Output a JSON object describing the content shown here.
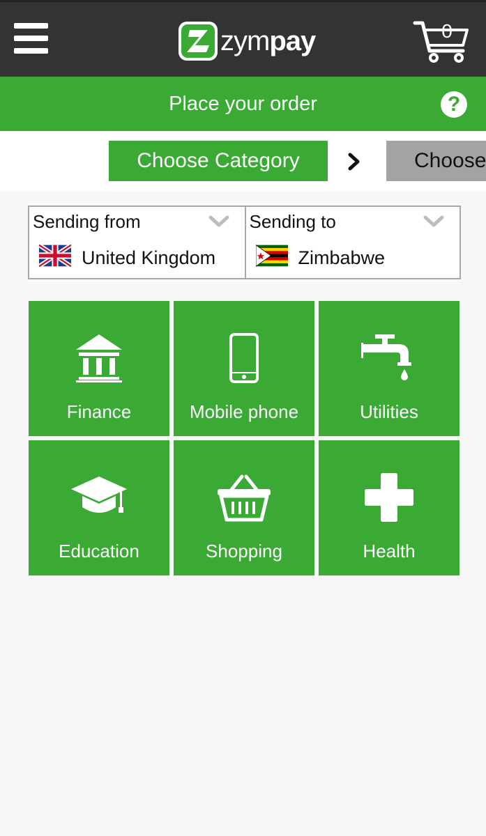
{
  "app": {
    "brand_left": "zym",
    "brand_right": "pay",
    "cart_count": "0"
  },
  "header": {
    "title": "Place your order",
    "help_icon": "question-circle-icon"
  },
  "steps": {
    "active_label": "Choose Category",
    "next_label": "Choose"
  },
  "route": {
    "from_label": "Sending from",
    "from_country": "United Kingdom",
    "to_label": "Sending to",
    "to_country": "Zimbabwe"
  },
  "categories": [
    {
      "label": "Finance",
      "icon": "bank-icon"
    },
    {
      "label": "Mobile phone",
      "icon": "mobile-phone-icon"
    },
    {
      "label": "Utilities",
      "icon": "water-tap-icon"
    },
    {
      "label": "Education",
      "icon": "graduation-cap-icon"
    },
    {
      "label": "Shopping",
      "icon": "shopping-basket-icon"
    },
    {
      "label": "Health",
      "icon": "medical-cross-icon"
    }
  ],
  "colors": {
    "brand_green": "#3aaa35",
    "topbar": "#333333",
    "inactive_step": "#a3a3a3"
  }
}
